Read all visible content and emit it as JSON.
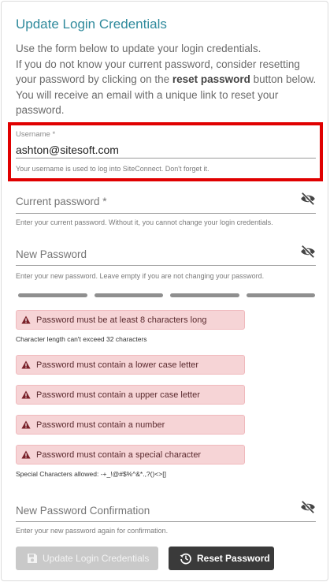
{
  "title": "Update Login Credentials",
  "intro": {
    "line1": "Use the form below to update your login credentials.",
    "line2_pre": "If you do not know your current password, consider resetting your password by clicking on the ",
    "line2_bold": "reset password",
    "line2_post": " button below. You will receive an email with a unique link to reset your password."
  },
  "username": {
    "label": "Username *",
    "value": "ashton@sitesoft.com",
    "hint": "Your username is used to log into SiteConnect. Don't forget it."
  },
  "current_password": {
    "placeholder": "Current password *",
    "hint": "Enter your current password. Without it, you cannot change your login credentials."
  },
  "new_password": {
    "placeholder": "New Password",
    "hint": "Enter your new password. Leave empty if you are not changing your password."
  },
  "errors": {
    "min_length": "Password must be at least 8 characters long",
    "max_length_note": "Character length can't exceed 32 characters",
    "lower": "Password must contain a lower case letter",
    "upper": "Password must contain a upper case letter",
    "number": "Password must contain a number",
    "special": "Password must contain a special character",
    "special_note": "Special Characters allowed: -+_!@#$%^&*.,?()<>[]"
  },
  "confirm_password": {
    "placeholder": "New Password Confirmation",
    "hint": "Enter your new password again for confirmation."
  },
  "buttons": {
    "update": "Update Login Credentials",
    "reset": "Reset Password"
  },
  "colors": {
    "accent": "#2f8a9c",
    "highlight_border": "#e00000",
    "error_bg": "#f6d4d6",
    "error_icon": "#7a1f28"
  },
  "icons": {
    "visibility_toggle": "eye-off-icon",
    "warning": "warning-triangle-icon",
    "save": "floppy-disk-icon",
    "reset": "history-icon"
  }
}
